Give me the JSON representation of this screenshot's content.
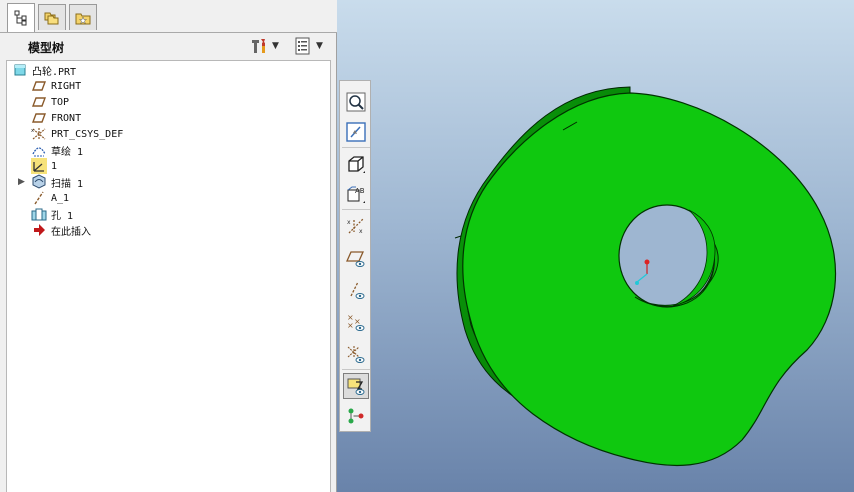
{
  "tabs": [
    {
      "name": "model-tree-tab",
      "icon": "model-tree-icon"
    },
    {
      "name": "folder-browser-tab",
      "icon": "folder-browser-icon"
    },
    {
      "name": "favorites-tab",
      "icon": "favorites-icon"
    }
  ],
  "model_tree": {
    "title": "模型树",
    "settings_icon": "tree-settings-icon",
    "columns_icon": "tree-columns-icon",
    "items": [
      {
        "label": "凸轮.PRT",
        "icon": "part-icon"
      },
      {
        "label": "RIGHT",
        "icon": "datum-plane-icon"
      },
      {
        "label": "TOP",
        "icon": "datum-plane-icon"
      },
      {
        "label": "FRONT",
        "icon": "datum-plane-icon"
      },
      {
        "label": "PRT_CSYS_DEF",
        "icon": "coordinate-system-icon"
      },
      {
        "label": "草绘 1",
        "icon": "sketch-icon"
      },
      {
        "label": "1",
        "icon": "coordinate-system-small-icon"
      },
      {
        "label": "扫描 1",
        "icon": "sweep-icon",
        "expandable": true
      },
      {
        "label": "A_1",
        "icon": "datum-axis-icon"
      },
      {
        "label": "孔 1",
        "icon": "hole-icon"
      },
      {
        "label": "在此插入",
        "icon": "insert-here-arrow-icon"
      }
    ]
  },
  "toolbar": [
    {
      "name": "zoom-to-fit-button",
      "icon": "magnifier-icon"
    },
    {
      "name": "repaint-button",
      "icon": "repaint-icon"
    },
    {
      "name": "display-style-button",
      "icon": "shaded-cube-icon"
    },
    {
      "name": "saved-views-button",
      "icon": "saved-views-icon"
    },
    {
      "name": "annotation-display-button",
      "icon": "annotation-display-icon"
    },
    {
      "name": "plane-display-button",
      "icon": "plane-display-icon"
    },
    {
      "name": "axis-display-button",
      "icon": "axis-display-icon"
    },
    {
      "name": "point-display-button",
      "icon": "point-display-icon"
    },
    {
      "name": "csys-display-button",
      "icon": "csys-display-icon"
    },
    {
      "name": "spin-center-button",
      "icon": "spin-center-icon"
    },
    {
      "name": "model-tree-display-button",
      "icon": "model-tree-display-icon"
    }
  ],
  "colors": {
    "model_face": "#0fc80f",
    "model_side": "#08a008",
    "model_edge": "#003300",
    "viewport_top": "#c9dcec",
    "viewport_bottom": "#6983aa"
  }
}
